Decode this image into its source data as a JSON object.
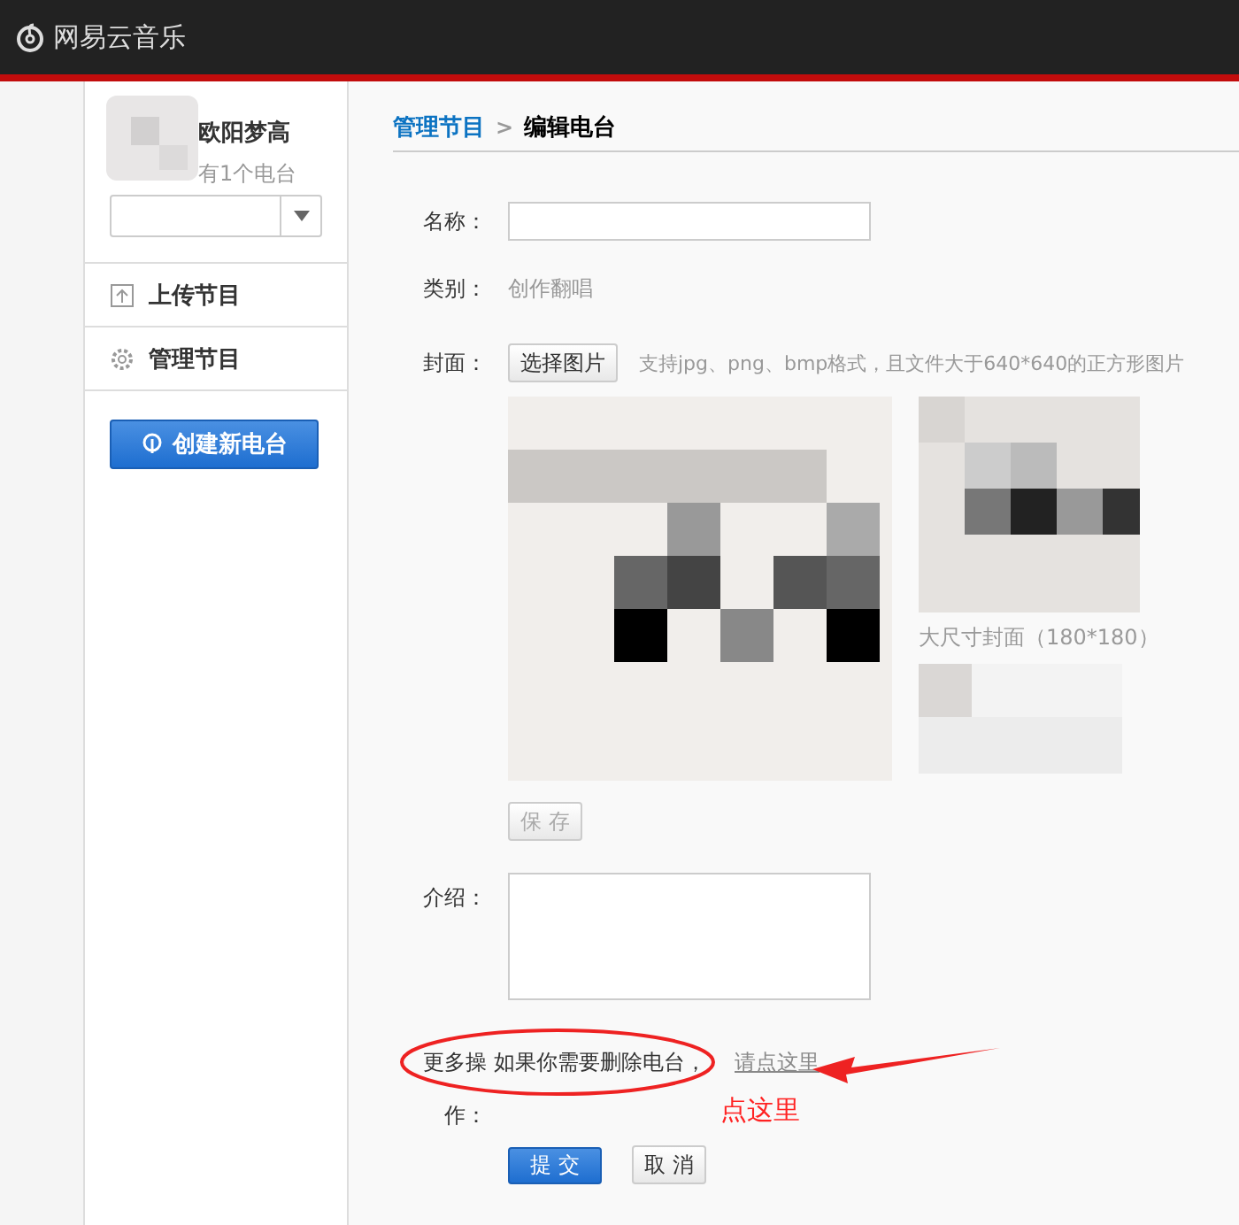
{
  "app": {
    "title": "网易云音乐"
  },
  "sidebar": {
    "user_name": "欧阳梦高",
    "station_count": "有1个电台",
    "menu": [
      {
        "label": "上传节目",
        "kind": "upload"
      },
      {
        "label": "管理节目",
        "kind": "manage"
      }
    ],
    "create_button": "创建新电台"
  },
  "breadcrumb": {
    "parent": "管理节目",
    "separator": ">",
    "current": "编辑电台"
  },
  "form": {
    "name_label": "名称：",
    "category_label": "类别：",
    "category": "创作翻唱",
    "cover_label": "封面：",
    "choose_button": "选择图片",
    "cover_hint": "支持jpg、png、bmp格式，且文件大于640*640的正方形图片",
    "large_caption": "大尺寸封面（180*180）",
    "save_button": {
      "label": "保 存",
      "disabled": true
    },
    "intro_label": "介绍：",
    "more_label": "更多操作：",
    "delete_text": "如果你需要删除电台，",
    "delete_link": "请点这里",
    "submit_button": "提 交",
    "cancel_button": "取 消"
  },
  "annotation": {
    "text": "点这里"
  }
}
